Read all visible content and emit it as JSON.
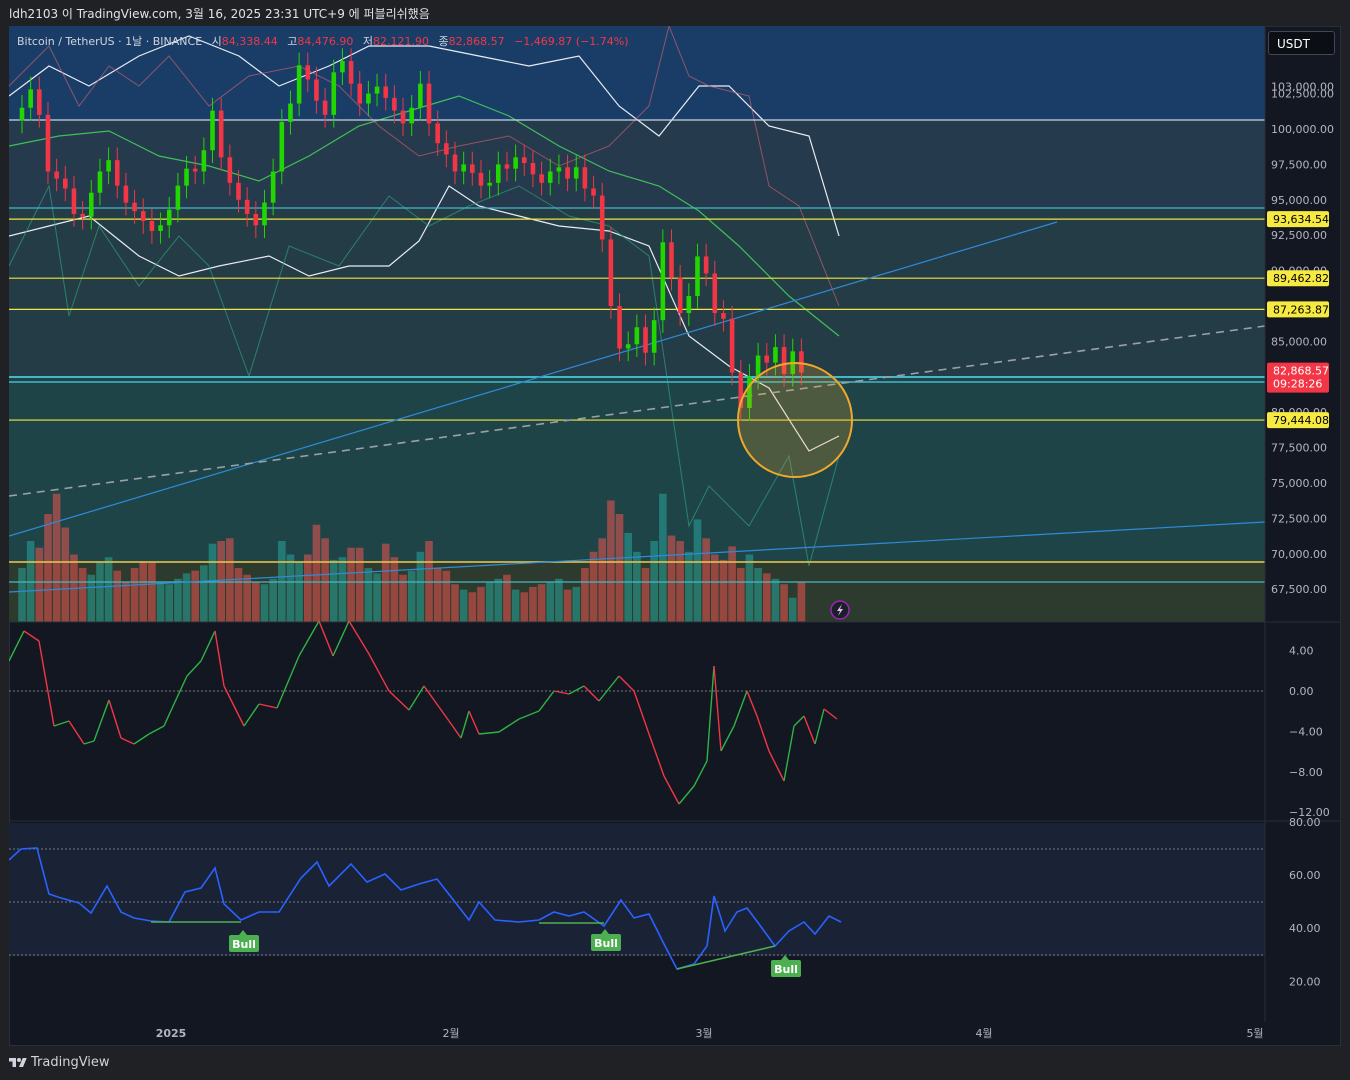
{
  "header": {
    "caption": "ldh2103 이 TradingView.com, 3월 16, 2025 23:31 UTC+9 에 퍼블리쉬했음"
  },
  "footer": {
    "brand": "TradingView",
    "logo_icon": "tradingview-logo-icon"
  },
  "currency_button": {
    "label": "USDT"
  },
  "legend": {
    "symbol": "Bitcoin / TetherUS · 1날 · BINANCE",
    "open_label": "시",
    "open_value": "84,338.44",
    "high_label": "고",
    "high_value": "84,476.90",
    "low_label": "저",
    "low_value": "82,121.90",
    "close_label": "종",
    "close_value": "82,868.57",
    "change": "−1,469.87 (−1.74%)"
  },
  "colors": {
    "up": "#22d600",
    "down": "#f23645",
    "yellow_line": "#f0e442",
    "cyan_line": "#44b7c9",
    "blue_trend": "#2e8bd8",
    "price_tag": "#f23645",
    "yellow_tag": "#f5e942",
    "orange_circle": "#f0a82a",
    "rsi_line": "#2962ff",
    "bull_label": "#4caf50",
    "bands": "#e8ecf4"
  },
  "price_axis": {
    "labels": [
      "103,000.00",
      "102,500.00",
      "100,000.00",
      "97,500.00",
      "95,000.00",
      "92,500.00",
      "90,000.00",
      "87,500.00",
      "85,000.00",
      "82,500.00",
      "80,000.00",
      "77,500.00",
      "75,000.00",
      "72,500.00",
      "70,000.00",
      "67,500.00"
    ],
    "tags": [
      {
        "text": "93,634.54",
        "price": 93634.54
      },
      {
        "text": "89,462.82",
        "price": 89462.82
      },
      {
        "text": "87,263.87",
        "price": 87263.87
      },
      {
        "text": "79,444.08",
        "price": 79444.08
      }
    ],
    "last_price": "82,868.57",
    "countdown": "09:28:26"
  },
  "osc_axis": {
    "labels": [
      "4.00",
      "0.00",
      "−4.00",
      "−8.00",
      "−12.00"
    ]
  },
  "rsi_axis": {
    "labels": [
      "80.00",
      "60.00",
      "40.00",
      "20.00"
    ]
  },
  "time_axis": {
    "labels": [
      "2025",
      "2월",
      "3월",
      "4월",
      "5월"
    ]
  },
  "annotations": {
    "bull_labels": [
      "Bull",
      "Bull",
      "Bull"
    ],
    "lightning_icon": "lightning-icon"
  }
}
